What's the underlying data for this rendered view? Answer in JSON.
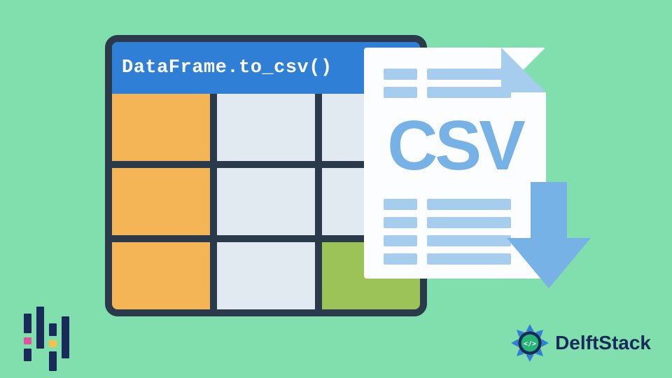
{
  "main": {
    "code_text": "DataFrame.to_csv()",
    "file_label": "CSV"
  },
  "cells": [
    {
      "class": "orange"
    },
    {
      "class": ""
    },
    {
      "class": ""
    },
    {
      "class": "orange"
    },
    {
      "class": ""
    },
    {
      "class": ""
    },
    {
      "class": "orange"
    },
    {
      "class": ""
    },
    {
      "class": "green"
    }
  ],
  "brand": {
    "name": "DelftStack"
  },
  "icons": {
    "pandas": "pandas-logo",
    "delft": "delftstack-logo",
    "arrow": "download-arrow",
    "file": "csv-file"
  }
}
